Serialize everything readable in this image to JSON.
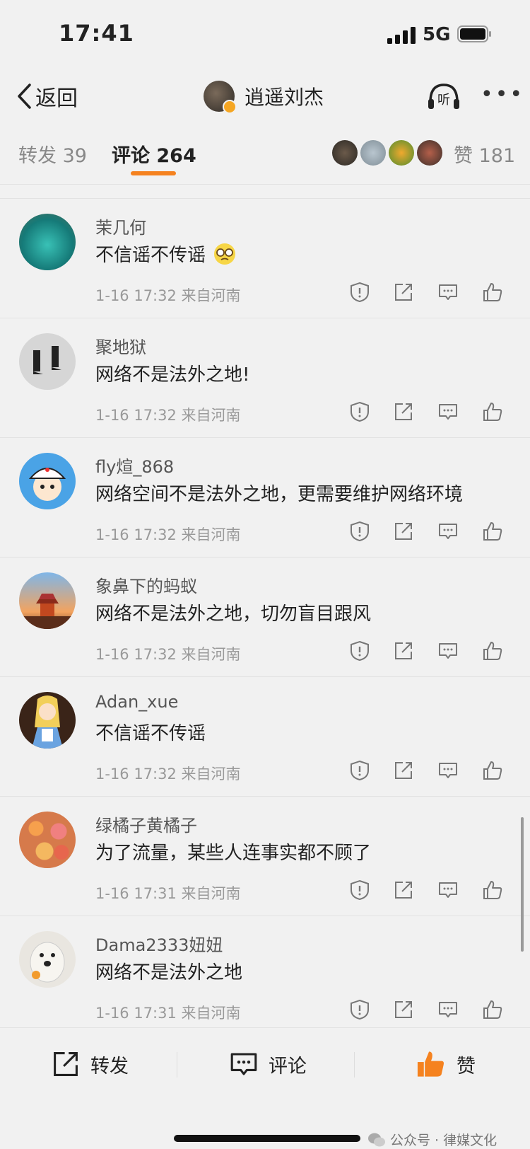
{
  "status": {
    "time": "17:41",
    "network": "5G"
  },
  "nav": {
    "back_label": "返回",
    "author": "逍遥刘杰",
    "listen_label": "听"
  },
  "tabs": {
    "repost": "转发 39",
    "comments": "评论 264",
    "likes": "赞 181"
  },
  "comments": [
    {
      "user": "茉几何",
      "text": "不信谣不传谣",
      "emoji": "face-with-glasses",
      "time": "1-16 17:32",
      "location": "来自河南",
      "avatar_color": "#2aa7a0"
    },
    {
      "user": "聚地狱",
      "text": "网络不是法外之地!",
      "time": "1-16 17:32",
      "location": "来自河南",
      "avatar_color": "#cfcfcf"
    },
    {
      "user": "fly煊_868",
      "text": "网络空间不是法外之地，更需要维护网络环境",
      "time": "1-16 17:32",
      "location": "来自河南",
      "avatar_color": "#3b8fd8"
    },
    {
      "user": "象鼻下的蚂蚁",
      "text": "网络不是法外之地，切勿盲目跟风",
      "time": "1-16 17:32",
      "location": "来自河南",
      "avatar_color": "#c0612f"
    },
    {
      "user": "Adan_xue",
      "text": "不信谣不传谣",
      "time": "1-16 17:32",
      "location": "来自河南",
      "avatar_color": "#e7c05a"
    },
    {
      "user": "绿橘子黄橘子",
      "text": "为了流量，某些人连事实都不顾了",
      "time": "1-16 17:31",
      "location": "来自河南",
      "avatar_color": "#e28a55"
    },
    {
      "user": "Dama2333妞妞",
      "text": "网络不是法外之地",
      "time": "1-16 17:31",
      "location": "来自河南",
      "avatar_color": "#d8d4cc"
    }
  ],
  "bottom": {
    "repost": "转发",
    "comment": "评论",
    "like": "赞"
  },
  "watermark": "公众号 · 律媒文化",
  "colors": {
    "accent": "#f5821f",
    "text": "#222222",
    "meta": "#999999",
    "background": "#f1f1f1"
  }
}
